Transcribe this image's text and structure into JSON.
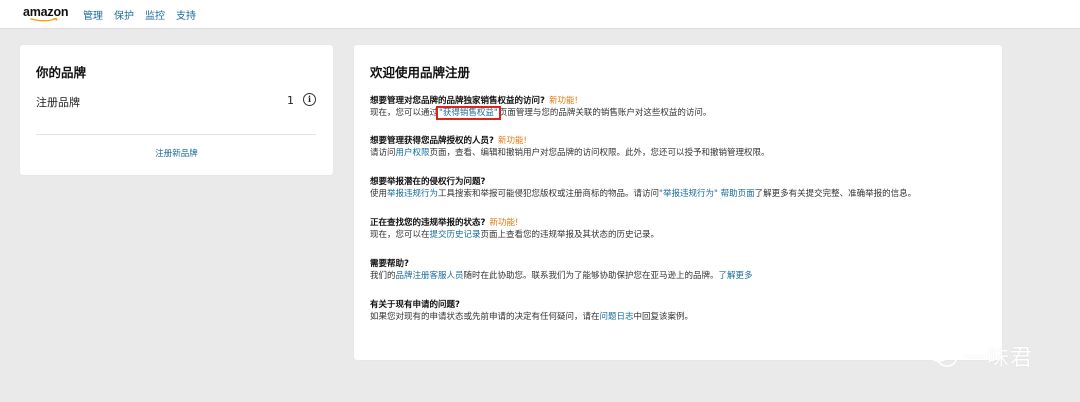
{
  "nav": {
    "logo": "amazon",
    "items": [
      "管理",
      "保护",
      "监控",
      "支持"
    ]
  },
  "brand_card": {
    "title": "你的品牌",
    "row_label": "注册品牌",
    "row_count": "1",
    "register_link": "注册新品牌"
  },
  "welcome": {
    "title": "欢迎使用品牌注册",
    "new_tag": "新功能!",
    "s1": {
      "q": "想要管理对您品牌的品牌独家销售权益的访问?",
      "b1": "现在，您可以通过",
      "link": "\"获得销售权益\"",
      "b2": "页面管理与您的品牌关联的销售账户对这些权益的访问。"
    },
    "s2": {
      "q": "想要管理获得您品牌授权的人员?",
      "b1": "请访问",
      "link": "用户权限",
      "b2": "页面，查看、编辑和撤销用户对您品牌的访问权限。此外，您还可以授予和撤销管理权限。"
    },
    "s3": {
      "q": "想要举报潜在的侵权行为问题?",
      "b1": "使用",
      "link1": "举报违规行为",
      "b2": "工具搜索和举报可能侵犯您版权或注册商标的物品。请访问",
      "link2": "\"举报违规行为\" 帮助页面",
      "b3": "了解更多有关提交完整、准确举报的信息。"
    },
    "s4": {
      "q": "正在查找您的违规举报的状态?",
      "b1": "现在，您可以在",
      "link": "提交历史记录",
      "b2": "页面上查看您的违规举报及其状态的历史记录。"
    },
    "s5": {
      "q": "需要帮助?",
      "b1": "我们的",
      "link1": "品牌注册客服人员",
      "b2": "随时在此协助您。联系我们为了能够协助保护您在亚马逊上的品牌。",
      "link2": "了解更多"
    },
    "s6": {
      "q": "有关于现有申请的问题?",
      "b1": "如果您对现有的申请状态或先前申请的决定有任何疑问，请在",
      "link": "问题日志",
      "b2": "中回复该案例。"
    }
  },
  "watermark": {
    "text": "一味君"
  }
}
